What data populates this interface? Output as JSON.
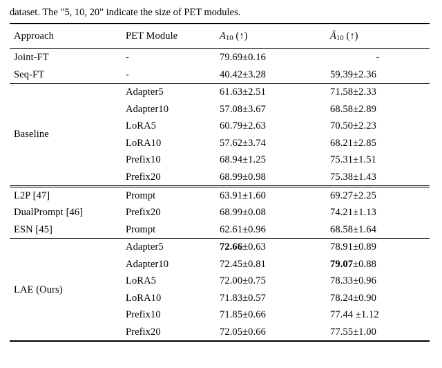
{
  "caption_fragment": "dataset. The \"5, 10, 20\" indicate the size of PET modules.",
  "header": {
    "approach": "Approach",
    "module": "PET Module",
    "a10_html": "<span class='ital'>A</span><span class='sub'>10</span> (↑)",
    "abar_html": "<span class='ital'>Ā</span><span class='sub'>10</span> (↑)"
  },
  "groups": [
    {
      "name_rows": [
        "Joint-FT",
        "Seq-FT"
      ],
      "rows": [
        {
          "module": "-",
          "a10": "79.69±0.16",
          "abar": "-"
        },
        {
          "module": "-",
          "a10": "40.42±3.28",
          "abar": "59.39±2.36"
        }
      ]
    },
    {
      "name_rows": [
        "Baseline"
      ],
      "rows": [
        {
          "module": "Adapter5",
          "a10": "61.63±2.51",
          "abar": "71.58±2.33"
        },
        {
          "module": "Adapter10",
          "a10": "57.08±3.67",
          "abar": "68.58±2.89"
        },
        {
          "module": "LoRA5",
          "a10": "60.79±2.63",
          "abar": "70.50±2.23"
        },
        {
          "module": "LoRA10",
          "a10": "57.62±3.74",
          "abar": "68.21±2.85"
        },
        {
          "module": "Prefix10",
          "a10": "68.94±1.25",
          "abar": "75.31±1.51"
        },
        {
          "module": "Prefix20",
          "a10": "68.99±0.98",
          "abar": "75.38±1.43"
        }
      ]
    },
    {
      "name_rows": [
        "L2P [47]",
        "DualPrompt [46]",
        "ESN [45]"
      ],
      "rows": [
        {
          "module": "Prompt",
          "a10": "63.91±1.60",
          "abar": "69.27±2.25"
        },
        {
          "module": "Prefix20",
          "a10": "68.99±0.08",
          "abar": "74.21±1.13"
        },
        {
          "module": "Prompt",
          "a10": "62.61±0.96",
          "abar": "68.58±1.64"
        }
      ]
    },
    {
      "name_rows": [
        "LAE (Ours)"
      ],
      "rows": [
        {
          "module": "Adapter5",
          "a10_html": "<span class='bold'>72.66</span>±0.63",
          "abar": "78.91±0.89"
        },
        {
          "module": "Adapter10",
          "a10": "72.45±0.81",
          "abar_html": "<span class='bold'>79.07</span>±0.88"
        },
        {
          "module": "LoRA5",
          "a10": "72.00±0.75",
          "abar": "78.33±0.96"
        },
        {
          "module": "LoRA10",
          "a10": "71.83±0.57",
          "abar": "78.24±0.90"
        },
        {
          "module": "Prefix10",
          "a10": "71.85±0.66",
          "abar": "77.44 ±1.12"
        },
        {
          "module": "Prefix20",
          "a10": "72.05±0.66",
          "abar": "77.55±1.00"
        }
      ]
    }
  ],
  "chart_data": {
    "type": "table",
    "columns": [
      "Approach",
      "PET Module",
      "A10",
      "Ā10"
    ],
    "rows": [
      [
        "Joint-FT",
        "-",
        "79.69±0.16",
        "-"
      ],
      [
        "Seq-FT",
        "-",
        "40.42±3.28",
        "59.39±2.36"
      ],
      [
        "Baseline",
        "Adapter5",
        "61.63±2.51",
        "71.58±2.33"
      ],
      [
        "Baseline",
        "Adapter10",
        "57.08±3.67",
        "68.58±2.89"
      ],
      [
        "Baseline",
        "LoRA5",
        "60.79±2.63",
        "70.50±2.23"
      ],
      [
        "Baseline",
        "LoRA10",
        "57.62±3.74",
        "68.21±2.85"
      ],
      [
        "Baseline",
        "Prefix10",
        "68.94±1.25",
        "75.31±1.51"
      ],
      [
        "Baseline",
        "Prefix20",
        "68.99±0.98",
        "75.38±1.43"
      ],
      [
        "L2P [47]",
        "Prompt",
        "63.91±1.60",
        "69.27±2.25"
      ],
      [
        "DualPrompt [46]",
        "Prefix20",
        "68.99±0.08",
        "74.21±1.13"
      ],
      [
        "ESN [45]",
        "Prompt",
        "62.61±0.96",
        "68.58±1.64"
      ],
      [
        "LAE (Ours)",
        "Adapter5",
        "72.66±0.63",
        "78.91±0.89"
      ],
      [
        "LAE (Ours)",
        "Adapter10",
        "72.45±0.81",
        "79.07±0.88"
      ],
      [
        "LAE (Ours)",
        "LoRA5",
        "72.00±0.75",
        "78.33±0.96"
      ],
      [
        "LAE (Ours)",
        "LoRA10",
        "71.83±0.57",
        "78.24±0.90"
      ],
      [
        "LAE (Ours)",
        "Prefix10",
        "71.85±0.66",
        "77.44±1.12"
      ],
      [
        "LAE (Ours)",
        "Prefix20",
        "72.05±0.66",
        "77.55±1.00"
      ]
    ]
  }
}
